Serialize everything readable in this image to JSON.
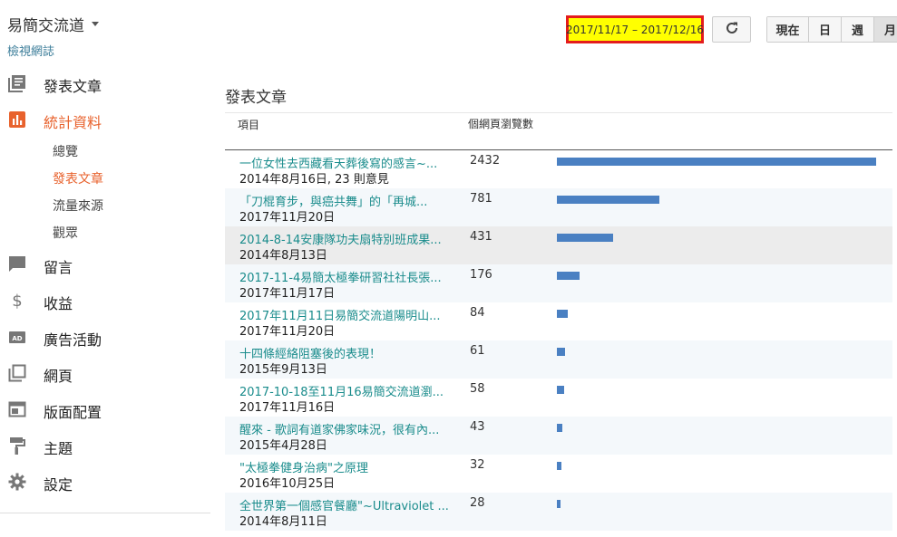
{
  "header": {
    "blog_title": "易簡交流道",
    "view_blog": "檢視網誌",
    "date_range": "2017/11/17 – 2017/12/16",
    "periods": [
      "現在",
      "日",
      "週",
      "月"
    ]
  },
  "sidebar": {
    "items": [
      {
        "label": "發表文章",
        "icon": "posts-icon"
      },
      {
        "label": "統計資料",
        "icon": "stats-icon",
        "active": true
      },
      {
        "label": "留言",
        "icon": "comments-icon"
      },
      {
        "label": "收益",
        "icon": "earnings-icon"
      },
      {
        "label": "廣告活動",
        "icon": "ads-icon"
      },
      {
        "label": "網頁",
        "icon": "pages-icon"
      },
      {
        "label": "版面配置",
        "icon": "layout-icon"
      },
      {
        "label": "主題",
        "icon": "theme-icon"
      },
      {
        "label": "設定",
        "icon": "settings-icon"
      }
    ],
    "stats_sub": [
      "總覽",
      "發表文章",
      "流量來源",
      "觀眾"
    ]
  },
  "main": {
    "title": "發表文章",
    "col_item": "項目",
    "col_views": "個網頁瀏覽數",
    "rows": [
      {
        "title": "一位女性去西藏看天葬後寫的感言~...",
        "date": "2014年8月16日, 23 則意見",
        "views": "2432"
      },
      {
        "title": "「刀棍育步，與癌共舞」的「再城...",
        "date": "2017年11月20日",
        "views": "781"
      },
      {
        "title": "2014-8-14安康隊功夫扇特別班成果...",
        "date": "2014年8月13日",
        "views": "431"
      },
      {
        "title": "2017-11-4易簡太極拳研習社社長張...",
        "date": "2017年11月17日",
        "views": "176"
      },
      {
        "title": "2017年11月11日易簡交流道陽明山...",
        "date": "2017年11月20日",
        "views": "84"
      },
      {
        "title": "十四條經絡阻塞後的表現！",
        "date": "2015年9月13日",
        "views": "61"
      },
      {
        "title": "2017-10-18至11月16易簡交流道瀏...",
        "date": "2017年11月16日",
        "views": "58"
      },
      {
        "title": "醒來 - 歌詞有道家佛家味況，很有內...",
        "date": "2015年4月28日",
        "views": "43"
      },
      {
        "title": "\"太極拳健身治病\"之原理",
        "date": "2016年10月25日",
        "views": "32"
      },
      {
        "title": "全世界第一個感官餐廳\"~Ultraviolet ...",
        "date": "2014年8月11日",
        "views": "28"
      }
    ]
  },
  "colors": {
    "accent": "#e8622d",
    "bar": "#4a80c2",
    "link": "#1a8c8c",
    "highlight": "#ffff00",
    "border": "#e41c1c"
  }
}
